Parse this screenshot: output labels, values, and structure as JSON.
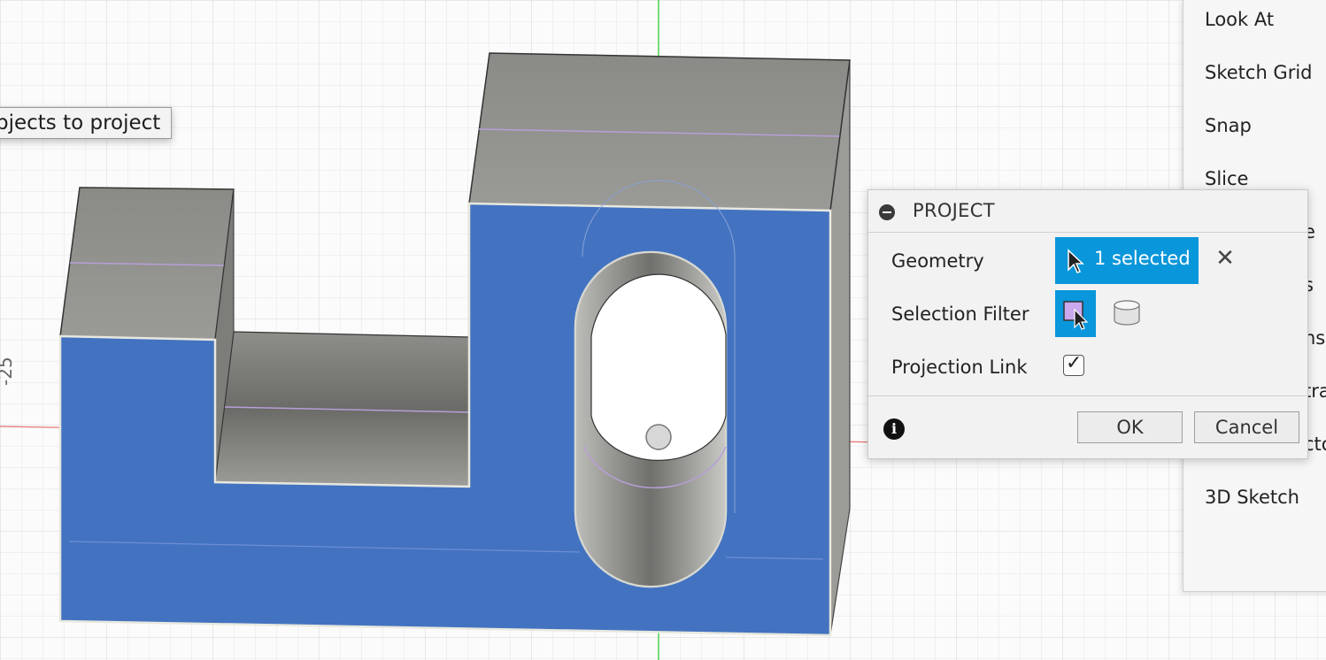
{
  "tooltip": {
    "text": "bjects to project"
  },
  "axis_label": "-25",
  "context_menu": {
    "items": [
      "Look At",
      "Sketch Grid",
      "Snap",
      "Slice",
      "e",
      "s",
      "ns",
      "tra",
      "cto",
      "3D Sketch"
    ]
  },
  "dialog": {
    "title": "PROJECT",
    "geometry_label": "Geometry",
    "geometry_value": "1 selected",
    "selection_filter_label": "Selection Filter",
    "projection_link_label": "Projection Link",
    "projection_link_checked": "✓",
    "ok_label": "OK",
    "cancel_label": "Cancel"
  },
  "colors": {
    "accent": "#0a96da",
    "selected_face": "#4373c0",
    "body_gray": "#8d8d89"
  },
  "icons": {
    "collapse": "collapse-icon",
    "cursor": "cursor-icon",
    "clear": "close-icon",
    "face_filter": "face-filter-icon",
    "body_filter": "body-filter-icon",
    "info": "info-icon"
  }
}
